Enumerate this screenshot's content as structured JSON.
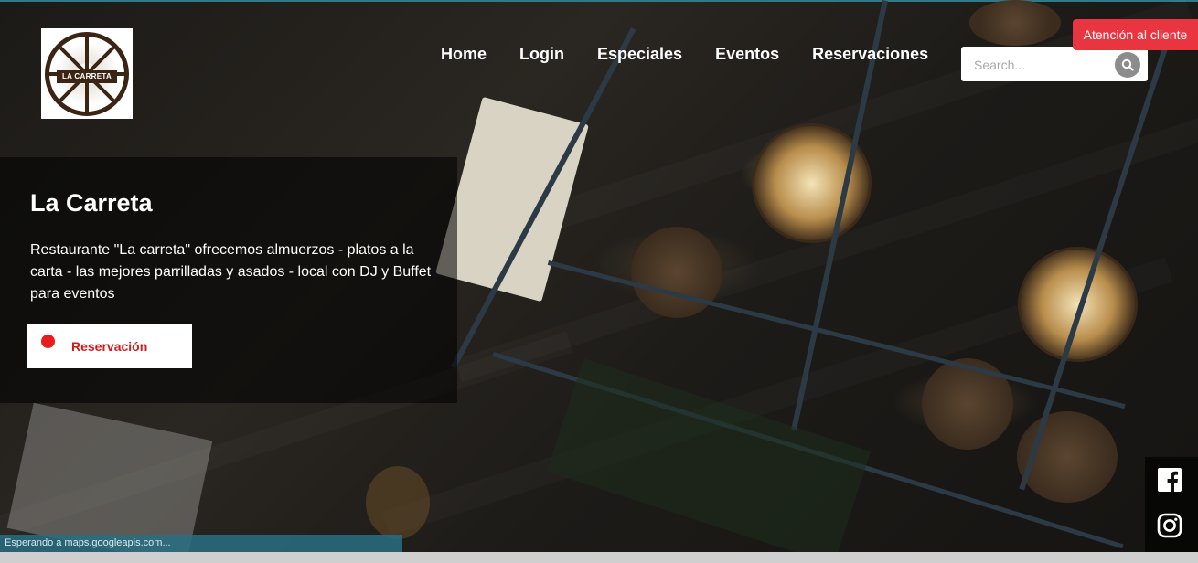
{
  "brand": {
    "logo_text": "LA CARRETA",
    "logo_icon": "wagon-wheel-logo"
  },
  "nav": {
    "items": [
      {
        "label": "Home"
      },
      {
        "label": "Login"
      },
      {
        "label": "Especiales"
      },
      {
        "label": "Eventos"
      },
      {
        "label": "Reservaciones"
      }
    ]
  },
  "search": {
    "placeholder": "Search...",
    "icon": "search-icon"
  },
  "support": {
    "label": "Atención al cliente"
  },
  "hero": {
    "title": "La Carreta",
    "description": "Restaurante \"La carreta\" ofrecemos almuerzos - platos a la carta - las mejores parrilladas y asados - local con DJ y Buffet para eventos",
    "reserve_label": "Reservación"
  },
  "social": {
    "icons": [
      "facebook-icon",
      "instagram-icon"
    ]
  },
  "status": {
    "text": "Esperando a maps.googleapis.com..."
  },
  "colors": {
    "accent_red": "#e8353f",
    "reserve_red": "#d11a1a",
    "status_bar": "#286e82"
  }
}
